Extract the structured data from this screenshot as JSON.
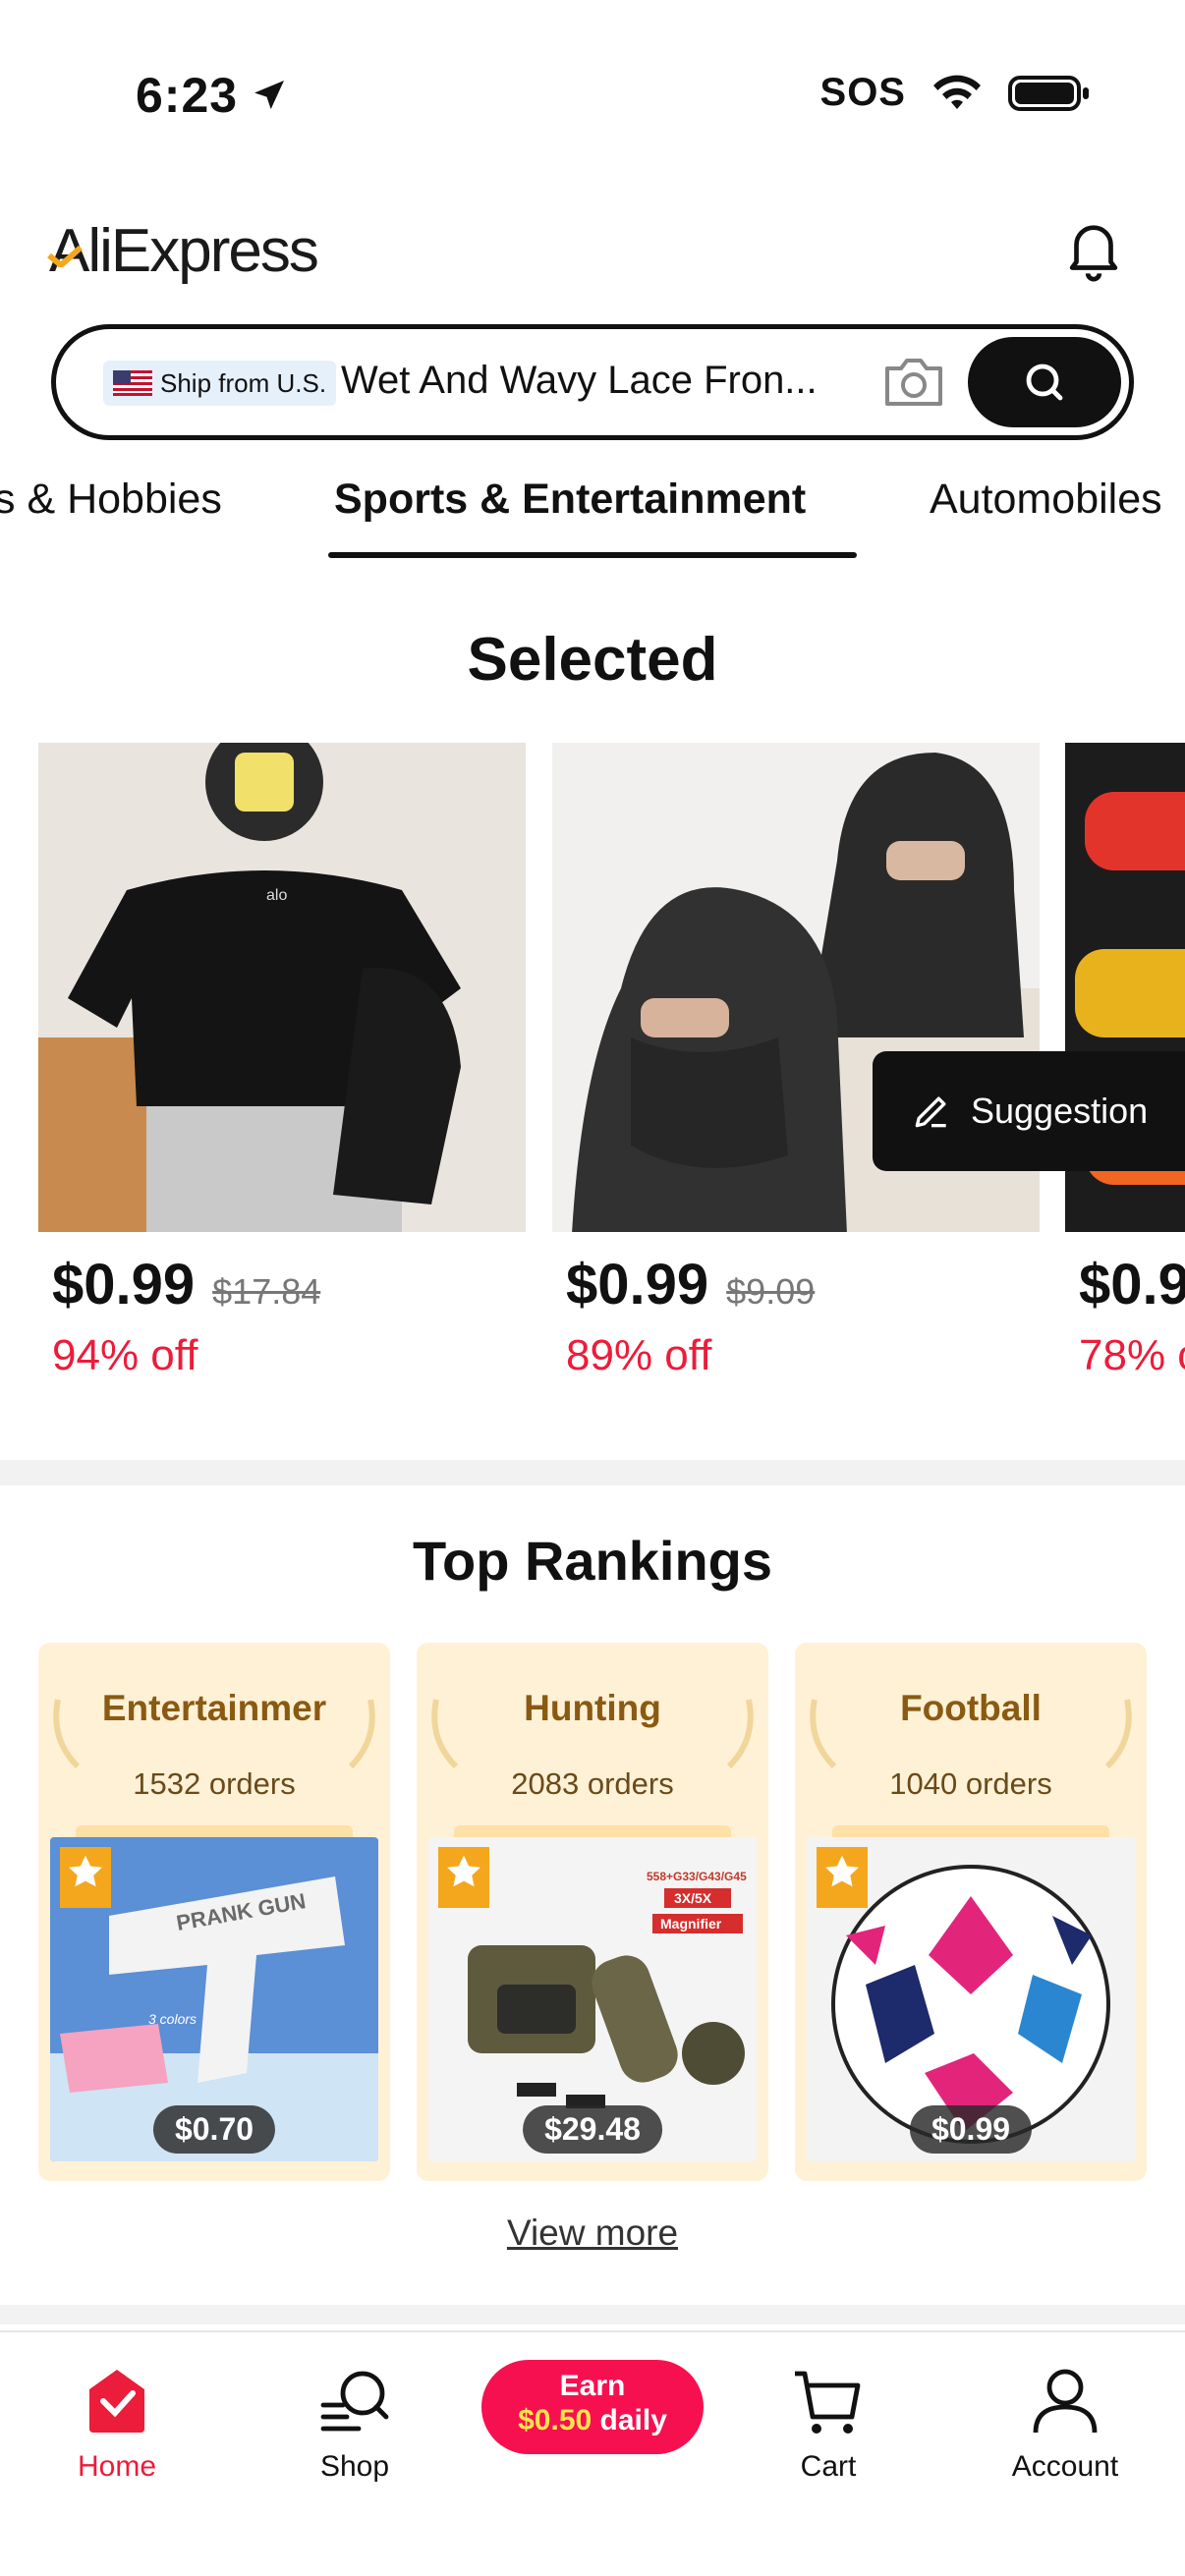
{
  "status_bar": {
    "time": "6:23",
    "sos": "SOS"
  },
  "header": {
    "logo": "AliExpress"
  },
  "search": {
    "ship_badge": "Ship from U.S.",
    "query": "Wet And Wavy Lace Fron..."
  },
  "category_tabs": [
    {
      "label": "s & Hobbies",
      "active": false
    },
    {
      "label": "Sports & Entertainment",
      "active": true
    },
    {
      "label": "Automobiles",
      "active": false
    }
  ],
  "selected": {
    "title": "Selected",
    "items": [
      {
        "price": "$0.99",
        "old_price": "$17.84",
        "discount": "94% off"
      },
      {
        "price": "$0.99",
        "old_price": "$9.09",
        "discount": "89% off"
      },
      {
        "price": "$0.9",
        "old_price": "",
        "discount": "78% o"
      }
    ],
    "suggestion_label": "Suggestion"
  },
  "top_rankings": {
    "title": "Top Rankings",
    "cards": [
      {
        "name": "Entertainmer",
        "orders": "1532 orders",
        "price": "$0.70",
        "image_text": "PRANK GUN",
        "image_sub": "3 colors"
      },
      {
        "name": "Hunting",
        "orders": "2083 orders",
        "price": "$29.48",
        "image_text": "558+G33/G43/G45",
        "image_sub": "3X/5X",
        "image_extra": "Magnifier"
      },
      {
        "name": "Football",
        "orders": "1040 orders",
        "price": "$0.99"
      }
    ],
    "view_more": "View more"
  },
  "bottom_nav": {
    "home": "Home",
    "shop": "Shop",
    "earn_top": "Earn",
    "earn_amount": "$0.50",
    "earn_suffix": " daily",
    "cart": "Cart",
    "account": "Account"
  },
  "colors": {
    "accent": "#ec1c3b",
    "earn_bg": "#f7104f",
    "rank_bg": "#fff1d6",
    "rank_text": "#8a5a12"
  }
}
